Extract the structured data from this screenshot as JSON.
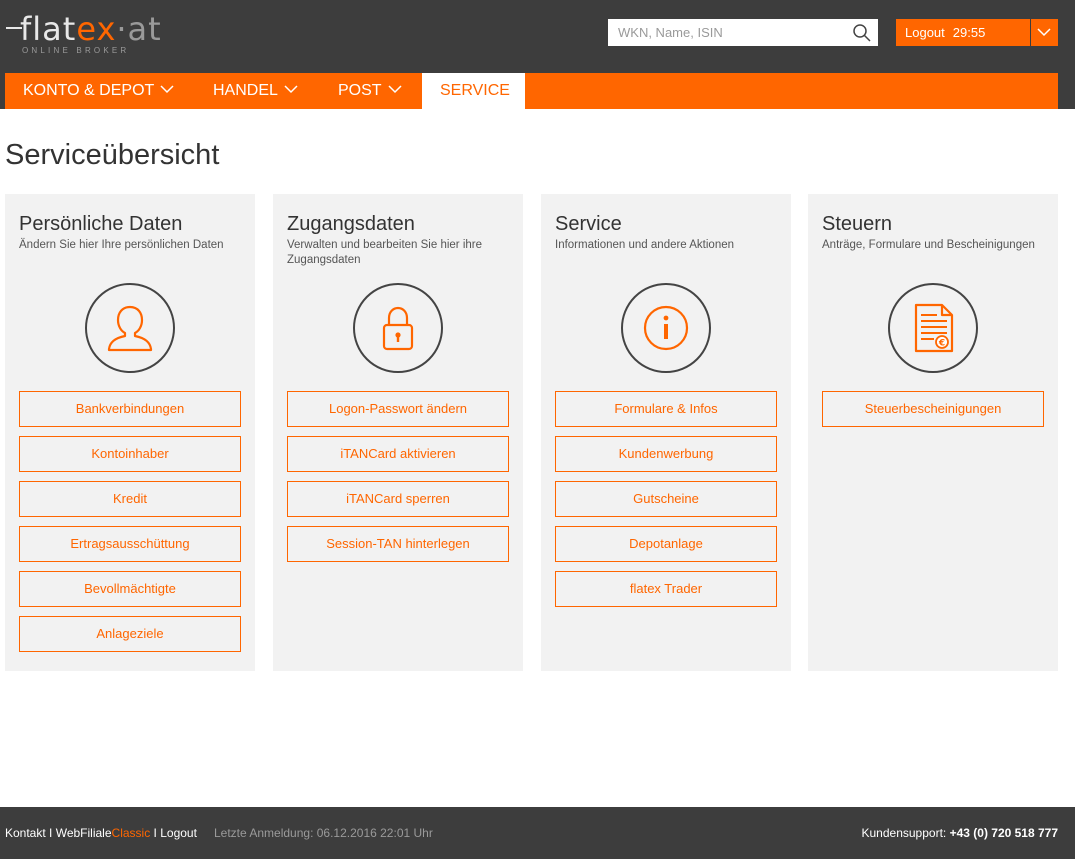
{
  "brand": {
    "logo_text_main": "flat",
    "logo_text_x": "ex",
    "logo_text_at": "·at",
    "logo_sub": "ONLINE BROKER",
    "accent_color": "#ff6600",
    "header_bg": "#3d3d3d"
  },
  "search": {
    "placeholder": "WKN, Name, ISIN",
    "value": ""
  },
  "logout": {
    "label": "Logout",
    "timer": "29:55"
  },
  "nav": {
    "items": [
      {
        "label": "KONTO & DEPOT",
        "has_dropdown": true
      },
      {
        "label": "HANDEL",
        "has_dropdown": true
      },
      {
        "label": "POST",
        "has_dropdown": true
      },
      {
        "label": "SERVICE",
        "active": true
      }
    ]
  },
  "main": {
    "title": "Serviceübersicht",
    "cards": [
      {
        "title": "Persönliche Daten",
        "desc": "Ändern Sie hier Ihre persönlichen Daten",
        "icon": "user-icon",
        "buttons": [
          "Bankverbindungen",
          "Kontoinhaber",
          "Kredit",
          "Ertragsausschüttung",
          "Bevollmächtigte",
          "Anlageziele"
        ]
      },
      {
        "title": "Zugangsdaten",
        "desc": "Verwalten und bearbeiten Sie hier ihre Zugangsdaten",
        "icon": "lock-icon",
        "buttons": [
          "Logon-Passwort ändern",
          "iTANCard aktivieren",
          "iTANCard sperren",
          "Session-TAN hinterlegen"
        ]
      },
      {
        "title": "Service",
        "desc": "Informationen und andere Aktionen",
        "icon": "info-icon",
        "buttons": [
          "Formulare & Infos",
          "Kundenwerbung",
          "Gutscheine",
          "Depotanlage",
          "flatex Trader"
        ]
      },
      {
        "title": "Steuern",
        "desc": "Anträge, Formulare und Bescheinigungen",
        "icon": "tax-document-icon",
        "buttons": [
          "Steuerbescheinigungen"
        ]
      }
    ]
  },
  "footer": {
    "contact": "Kontakt",
    "sep": " I ",
    "webfiliale": "WebFiliale",
    "classic": "Classic",
    "logout": "Logout",
    "last_login": "Letzte Anmeldung: 06.12.2016 22:01 Uhr",
    "support_label": "Kundensupport: ",
    "support_phone": "+43 (0) 720 518 777"
  }
}
